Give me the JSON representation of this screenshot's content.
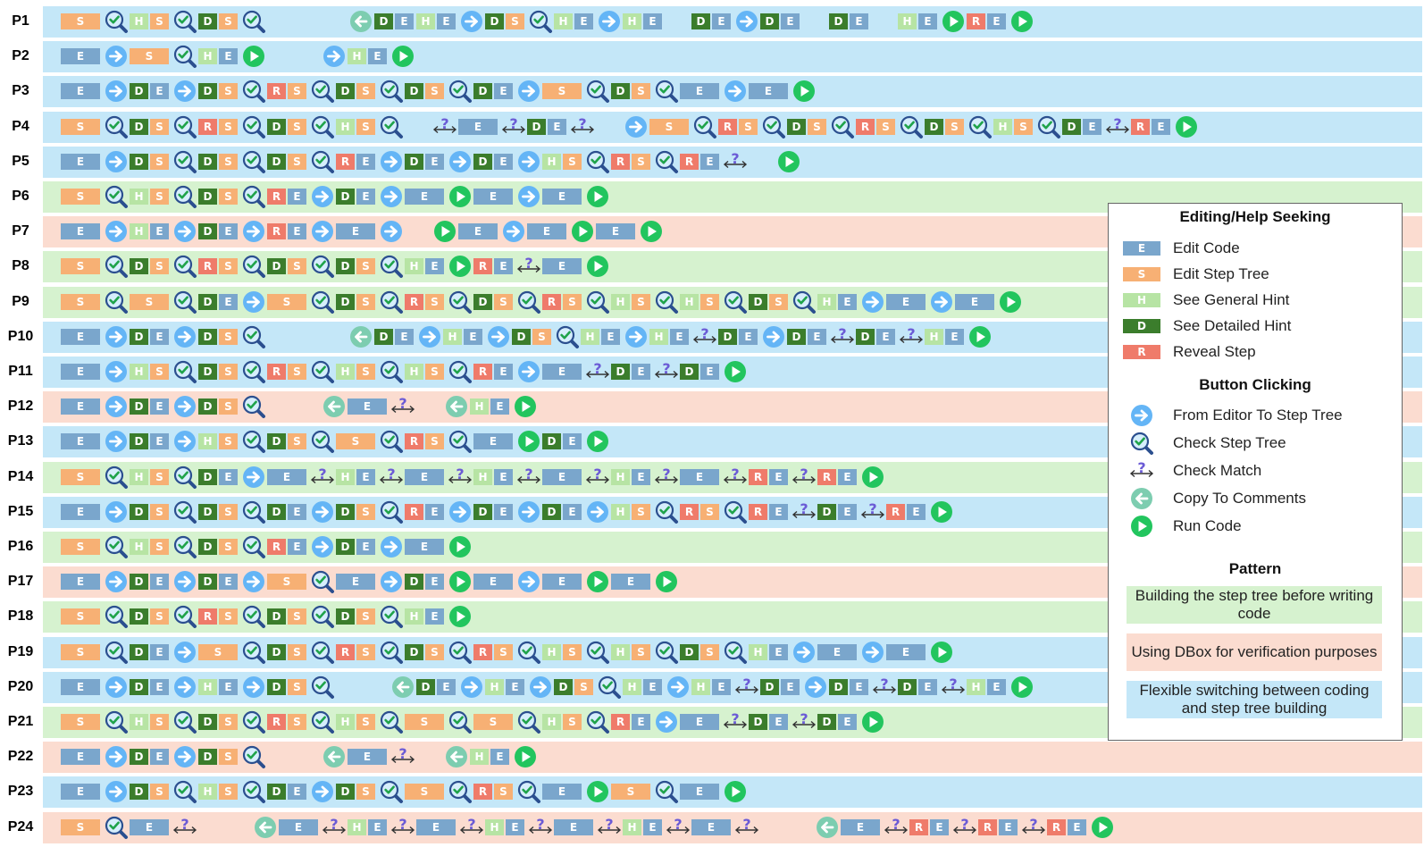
{
  "colors": {
    "E": "#7aa6cc",
    "S": "#f7b074",
    "H": "#b7e4a4",
    "D": "#3b7d2c",
    "R": "#ef7b6a",
    "arrow_icon": "#64b5f6",
    "copy_icon": "#7dcdb0",
    "run_icon": "#22c55e",
    "match_icon": "#6b5bd6",
    "pattern_green": "#d6f2cf",
    "pattern_salmon": "#fbdcd0",
    "pattern_blue": "#c4e7f8"
  },
  "legend": {
    "editing_title": "Editing/Help Seeking",
    "editing_items": [
      {
        "code": "E",
        "letter": "E",
        "label": "Edit Code"
      },
      {
        "code": "S",
        "letter": "S",
        "label": "Edit Step Tree"
      },
      {
        "code": "H",
        "letter": "H",
        "label": "See General Hint"
      },
      {
        "code": "D",
        "letter": "D",
        "label": "See Detailed Hint"
      },
      {
        "code": "R",
        "letter": "R",
        "label": "Reveal Step"
      }
    ],
    "button_title": "Button Clicking",
    "button_items": [
      {
        "icon": "arrow",
        "label": "From Editor To Step Tree"
      },
      {
        "icon": "check",
        "label": "Check Step Tree"
      },
      {
        "icon": "match",
        "label": "Check Match"
      },
      {
        "icon": "copy",
        "label": "Copy To Comments"
      },
      {
        "icon": "run",
        "label": "Run Code"
      }
    ],
    "pattern_title": "Pattern",
    "pattern_items": [
      {
        "pattern": "green",
        "label": "Building the step tree before writing code"
      },
      {
        "pattern": "salmon",
        "label": "Using DBox for verification purposes"
      },
      {
        "pattern": "blue",
        "label": "Flexible switching between coding and step tree building"
      }
    ]
  },
  "rows": [
    {
      "label": "P1",
      "pattern": "blue",
      "seq": "S Q HS Q DS Q _ _ _ C DE HE A DS Q HE A HE _ DE A DE _ DE _ HE G RE G"
    },
    {
      "label": "P2",
      "pattern": "blue",
      "seq": "E A S Q HE G _ _ A HE G"
    },
    {
      "label": "P3",
      "pattern": "blue",
      "seq": "E A DE A DS Q RS Q DS Q DS Q DE A S Q DS Q E A E G"
    },
    {
      "label": "P4",
      "pattern": "blue",
      "seq": "S Q DS Q RS Q DS Q HS Q _ M E M DE M _ A S Q RS Q DS Q RS Q DS Q HS Q DE M RE G"
    },
    {
      "label": "P5",
      "pattern": "blue",
      "seq": "E A DS Q DS Q DS Q RE A DE A DE A HS Q RS Q RE M _ G"
    },
    {
      "label": "P6",
      "pattern": "green",
      "seq": "S Q HS Q DS Q RE A DE A E G E A E G"
    },
    {
      "label": "P7",
      "pattern": "salmon",
      "seq": "E A HE A DE A RE A E A _ G E A E G E G"
    },
    {
      "label": "P8",
      "pattern": "green",
      "seq": "S Q DS Q RS Q DS Q DS Q HE G RE M E G"
    },
    {
      "label": "P9",
      "pattern": "green",
      "seq": "S Q S Q DE A S Q DS Q RS Q DS Q RS Q HS Q HS Q DS Q HE A E A E G"
    },
    {
      "label": "P10",
      "pattern": "blue",
      "seq": "E A DE A DS Q _ _ _ C DE A HE A DS Q HE A HE M DE A DE M DE M HE G"
    },
    {
      "label": "P11",
      "pattern": "blue",
      "seq": "E A HS Q DS Q RS Q HS Q HS Q RE A E M DE M DE G"
    },
    {
      "label": "P12",
      "pattern": "salmon",
      "seq": "E A DE A DS Q _ _ C E M _ C HE G"
    },
    {
      "label": "P13",
      "pattern": "blue",
      "seq": "E A DE A HS Q DS Q S Q RS Q E G DE G"
    },
    {
      "label": "P14",
      "pattern": "green",
      "seq": "S Q HS Q DE A E M HE M E M HE M E M HE M E M RE M RE G"
    },
    {
      "label": "P15",
      "pattern": "blue",
      "seq": "E A DS Q DS Q DE A DS Q RE A DE A DE A HS Q RS Q RE M DE M RE G"
    },
    {
      "label": "P16",
      "pattern": "green",
      "seq": "S Q HS Q DS Q RE A DE A E G"
    },
    {
      "label": "P17",
      "pattern": "salmon",
      "seq": "E A DE A DE A S Q E A DE G E A E G E G"
    },
    {
      "label": "P18",
      "pattern": "green",
      "seq": "S Q DS Q RS Q DS Q DS Q HE G"
    },
    {
      "label": "P19",
      "pattern": "blue",
      "seq": "S Q DE A S Q DS Q RS Q DS Q RS Q HS Q HS Q DS Q HE A E A E G"
    },
    {
      "label": "P20",
      "pattern": "blue",
      "seq": "E A DE A HE A DS Q _ _ C DE A HE A DS Q HE A HE M DE A DE M DE M HE G"
    },
    {
      "label": "P21",
      "pattern": "green",
      "seq": "S Q HS Q DS Q RS Q HS Q S Q S Q HS Q RE A E M DE M DE G"
    },
    {
      "label": "P22",
      "pattern": "salmon",
      "seq": "E A DE A DS Q _ _ C E M _ C HE G"
    },
    {
      "label": "P23",
      "pattern": "blue",
      "seq": "E A DS Q HS Q DE A DS Q S Q RS Q E G S Q E G"
    },
    {
      "label": "P24",
      "pattern": "salmon",
      "seq": "S Q E M _ _ C E M HE M E M HE M E M HE M E M _ _ C E M RE M RE M RE G"
    }
  ]
}
